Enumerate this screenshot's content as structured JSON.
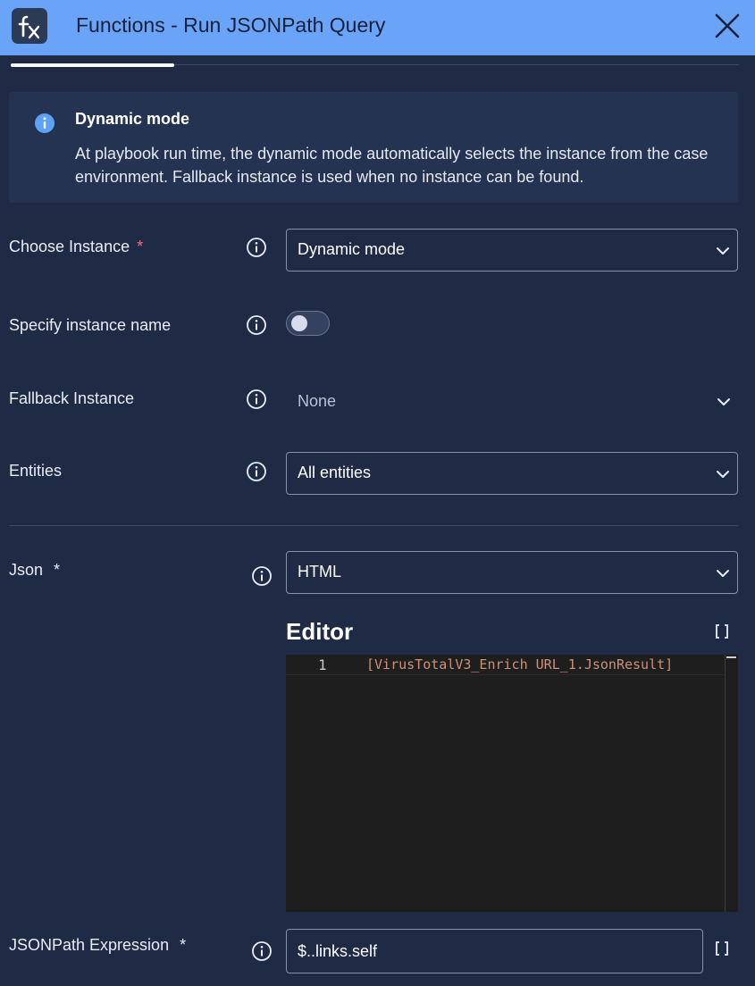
{
  "header": {
    "title": "Functions - Run JSONPath Query",
    "icon": "fx-icon",
    "accent": "#6aa4f8"
  },
  "banner": {
    "title": "Dynamic mode",
    "text": "At playbook run time, the dynamic mode automatically selects the instance from the case environment. Fallback instance is used when no instance can be found."
  },
  "fields": {
    "choose_instance": {
      "label": "Choose Instance",
      "required": "*",
      "value": "Dynamic mode"
    },
    "specify_instance_name": {
      "label": "Specify instance name",
      "enabled": false
    },
    "fallback_instance": {
      "label": "Fallback Instance",
      "value": "None"
    },
    "entities": {
      "label": "Entities",
      "value": "All entities"
    },
    "json": {
      "label": "Json",
      "required": "*",
      "value": "HTML"
    },
    "jsonpath_expression": {
      "label": "JSONPath Expression",
      "required": "*",
      "value": "$..links.self"
    }
  },
  "editor": {
    "title": "Editor",
    "lines": [
      {
        "number": "1",
        "code": "[VirusTotalV3_Enrich URL_1.JsonResult]"
      }
    ]
  }
}
